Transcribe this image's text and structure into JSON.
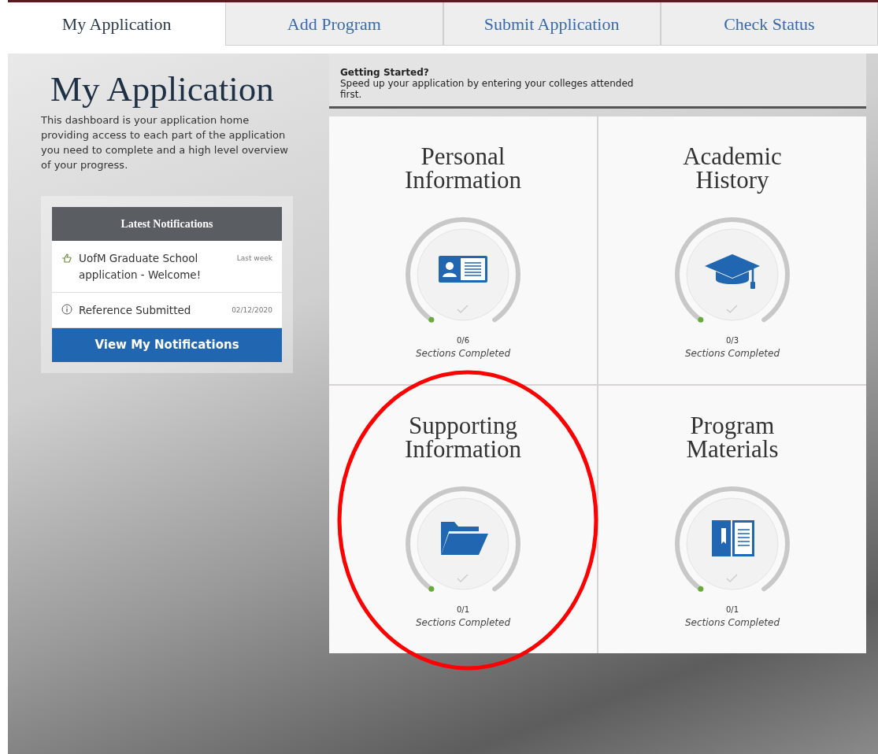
{
  "tabs": [
    {
      "label": "My Application",
      "selected": true
    },
    {
      "label": "Add Program",
      "selected": false
    },
    {
      "label": "Submit Application",
      "selected": false
    },
    {
      "label": "Check Status",
      "selected": false
    }
  ],
  "page": {
    "title": "My Application",
    "description": "This dashboard is your application home providing access to each part of the application you need to complete and a high level overview of your progress."
  },
  "notifications": {
    "title": "Latest Notifications",
    "items": [
      {
        "kind": "welcome",
        "text": "UofM Graduate School application - Welcome!",
        "time": "Last week"
      },
      {
        "kind": "info",
        "text": "Reference Submitted",
        "time": "02/12/2020"
      }
    ],
    "button": "View My Notifications"
  },
  "getting_started": {
    "title": "Getting Started?",
    "text": "Speed up your application by entering your colleges attended first."
  },
  "tiles": [
    {
      "kind": "id-card",
      "title": "Personal Information",
      "count": "0/6",
      "caption": "Sections Completed"
    },
    {
      "kind": "cap",
      "title": "Academic History",
      "count": "0/3",
      "caption": "Sections Completed"
    },
    {
      "kind": "folder",
      "title": "Supporting Information",
      "count": "0/1",
      "caption": "Sections Completed",
      "circled": true
    },
    {
      "kind": "book",
      "title": "Program Materials",
      "count": "0/1",
      "caption": "Sections Completed"
    }
  ],
  "annotation": {
    "kind": "circle"
  }
}
